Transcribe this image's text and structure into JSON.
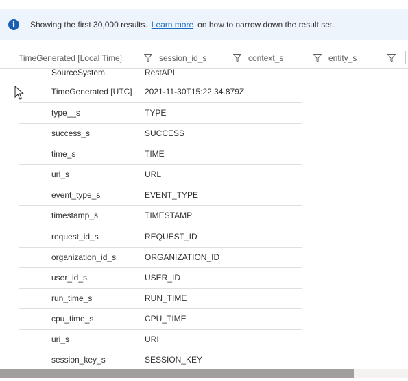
{
  "banner": {
    "text_before": "Showing the first 30,000 results.",
    "link": "Learn more",
    "text_after": "on how to narrow down the result set."
  },
  "columns": [
    {
      "label": "TimeGenerated [Local Time]"
    },
    {
      "label": "session_id_s"
    },
    {
      "label": "context_s"
    },
    {
      "label": "entity_s"
    }
  ],
  "rows": [
    {
      "key": "SourceSystem",
      "value": "RestAPI"
    },
    {
      "key": "TimeGenerated [UTC]",
      "value": "2021-11-30T15:22:34.879Z"
    },
    {
      "key": "type__s",
      "value": "TYPE"
    },
    {
      "key": "success_s",
      "value": "SUCCESS"
    },
    {
      "key": "time_s",
      "value": "TIME"
    },
    {
      "key": "url_s",
      "value": "URL"
    },
    {
      "key": "event_type_s",
      "value": "EVENT_TYPE"
    },
    {
      "key": "timestamp_s",
      "value": "TIMESTAMP"
    },
    {
      "key": "request_id_s",
      "value": "REQUEST_ID"
    },
    {
      "key": "organization_id_s",
      "value": "ORGANIZATION_ID"
    },
    {
      "key": "user_id_s",
      "value": "USER_ID"
    },
    {
      "key": "run_time_s",
      "value": "RUN_TIME"
    },
    {
      "key": "cpu_time_s",
      "value": "CPU_TIME"
    },
    {
      "key": "uri_s",
      "value": "URI"
    },
    {
      "key": "session_key_s",
      "value": "SESSION_KEY"
    }
  ],
  "icons": {
    "info": "info-icon",
    "filter": "filter-icon",
    "cursor": "mouse-pointer-icon"
  },
  "colors": {
    "banner_bg": "#eef4fc",
    "info_icon": "#1a5fb4",
    "link": "#1b6ec2",
    "scroll_thumb": "#a19f9d"
  }
}
